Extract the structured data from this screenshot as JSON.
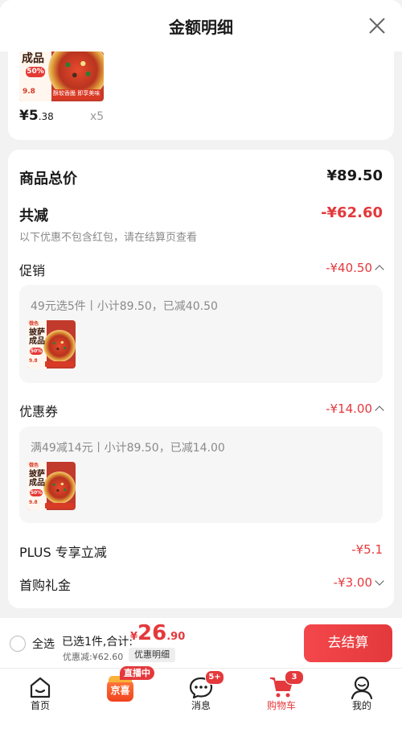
{
  "sheet": {
    "title": "金额明细"
  },
  "top_item": {
    "price_symbol": "¥",
    "price_int": "5",
    "price_dec": ".38",
    "quantity": "x5",
    "image_text": {
      "name": "成品",
      "discount": "50%",
      "price_tag": "9.8",
      "slogan": "酥软香脆 即享美味"
    }
  },
  "summary": {
    "goods_total_label": "商品总价",
    "goods_total_value": "¥89.50",
    "total_reduce_label": "共减",
    "total_reduce_value": "-¥62.60",
    "note": "以下优惠不包含红包，请在结算页查看"
  },
  "promotion": {
    "label": "促销",
    "value": "-¥40.50",
    "detail": "49元选5件丨小计89.50，已减40.50"
  },
  "coupon": {
    "label": "优惠券",
    "value": "-¥14.00",
    "detail": "满49减14元丨小计89.50，已减14.00"
  },
  "thumb_text": {
    "brand": "俄色",
    "name_line1": "披萨",
    "name_line2": "成品",
    "discount": "50%",
    "price_tag": "9.8"
  },
  "plus": {
    "label": "PLUS 专享立减",
    "value": "-¥5.1"
  },
  "first_buy": {
    "label": "首购礼金",
    "value": "-¥3.00"
  },
  "bottom_bar": {
    "select_all": "全选",
    "selected_summary": "已选1件,合计:",
    "currency": "¥",
    "total_int": "26",
    "total_dec": ".90",
    "discount_line": "优惠减:¥62.60",
    "discount_detail_btn": "优惠明细",
    "checkout_btn": "去结算"
  },
  "tabbar": {
    "items": [
      {
        "label": "首页",
        "icon": "home-icon"
      },
      {
        "label": "",
        "icon": "jingxi-logo",
        "logo_text": "京喜",
        "badge": "直播中"
      },
      {
        "label": "消息",
        "icon": "message-icon",
        "badge": "5+"
      },
      {
        "label": "购物车",
        "icon": "cart-icon",
        "badge": "3",
        "active": true
      },
      {
        "label": "我的",
        "icon": "profile-icon"
      }
    ]
  },
  "colors": {
    "accent": "#e4393c",
    "background": "#f2f2f2",
    "panel": "#f6f6f6"
  }
}
